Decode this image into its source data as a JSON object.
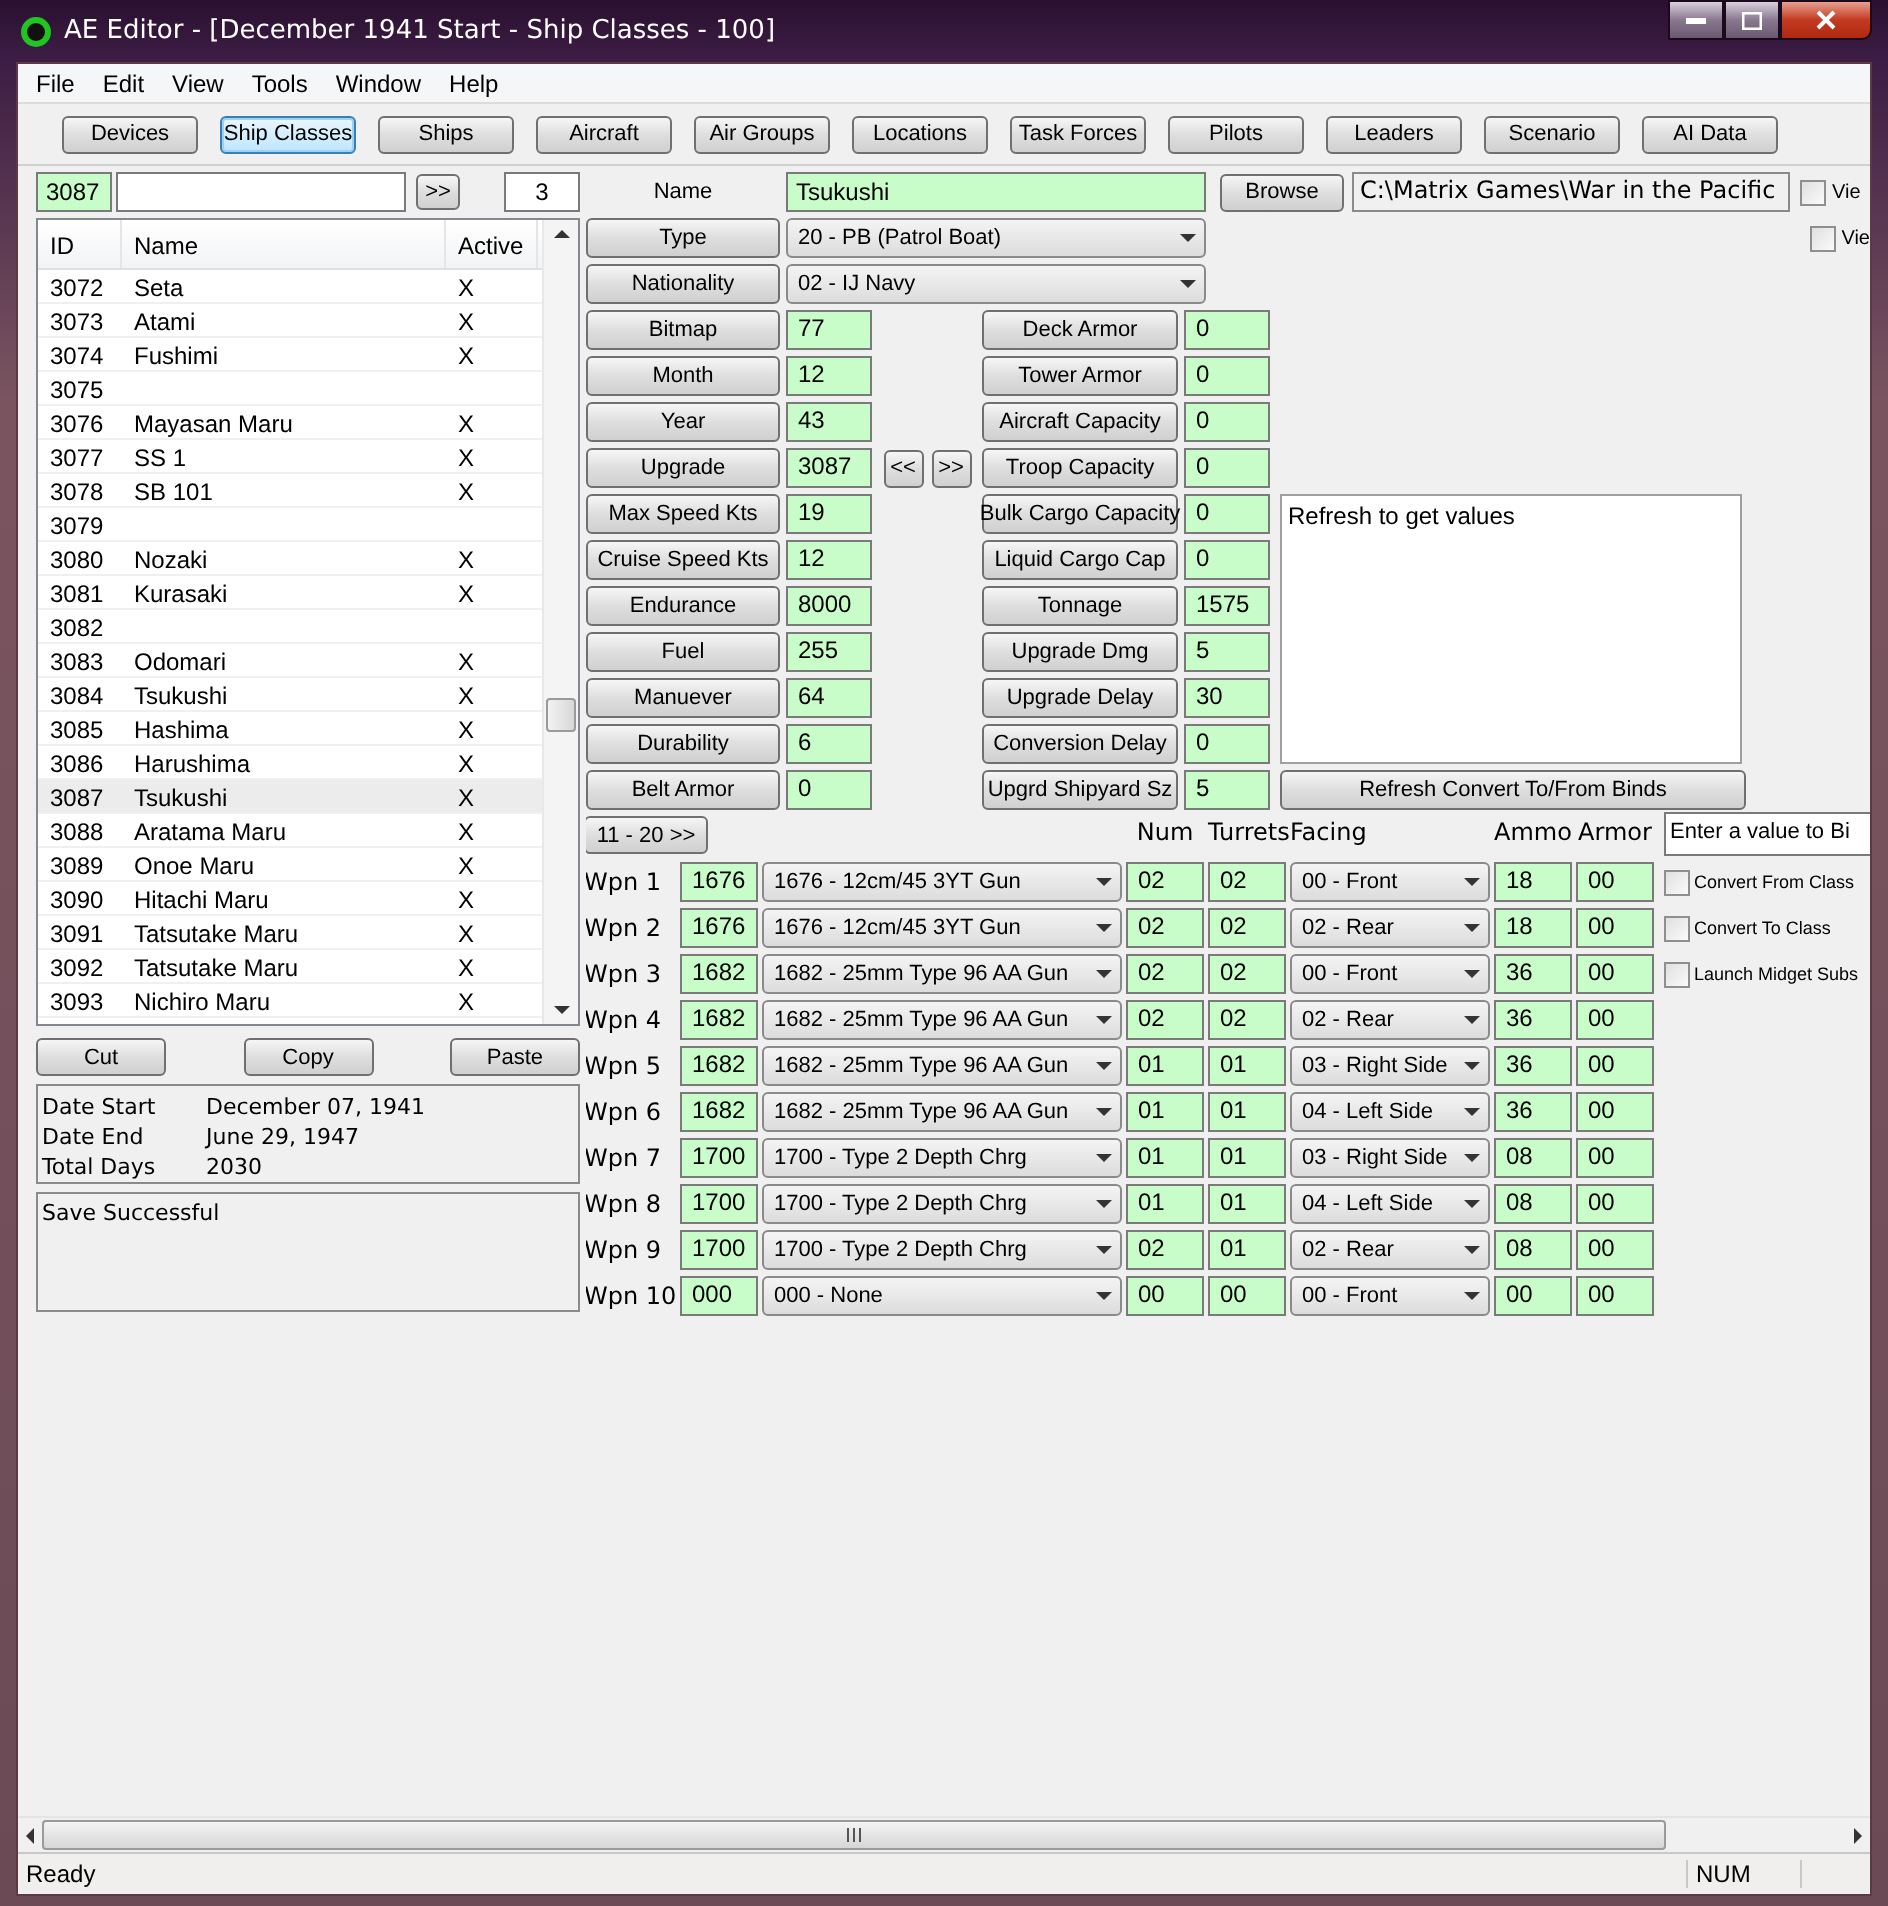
{
  "window": {
    "title": "AE Editor - [December 1941 Start - Ship Classes - 100]"
  },
  "menu": [
    "File",
    "Edit",
    "View",
    "Tools",
    "Window",
    "Help"
  ],
  "toolbar": [
    {
      "label": "Devices",
      "selected": false
    },
    {
      "label": "Ship Classes",
      "selected": true
    },
    {
      "label": "Ships",
      "selected": false
    },
    {
      "label": "Aircraft",
      "selected": false
    },
    {
      "label": "Air Groups",
      "selected": false
    },
    {
      "label": "Locations",
      "selected": false
    },
    {
      "label": "Task Forces",
      "selected": false
    },
    {
      "label": "Pilots",
      "selected": false
    },
    {
      "label": "Leaders",
      "selected": false
    },
    {
      "label": "Scenario",
      "selected": false
    },
    {
      "label": "AI Data",
      "selected": false
    }
  ],
  "list_panel": {
    "id_field": "3087",
    "next_button": ">>",
    "count": "3",
    "columns": [
      "ID",
      "Name",
      "Active"
    ],
    "rows": [
      {
        "id": "3072",
        "name": "Seta",
        "active": "X",
        "selected": false
      },
      {
        "id": "3073",
        "name": "Atami",
        "active": "X",
        "selected": false
      },
      {
        "id": "3074",
        "name": "Fushimi",
        "active": "X",
        "selected": false
      },
      {
        "id": "3075",
        "selected": false
      },
      {
        "id": "3076",
        "name": "Mayasan Maru",
        "active": "X",
        "selected": false
      },
      {
        "id": "3077",
        "name": "SS 1",
        "active": "X",
        "selected": false
      },
      {
        "id": "3078",
        "name": "SB 101",
        "active": "X",
        "selected": false
      },
      {
        "id": "3079",
        "selected": false
      },
      {
        "id": "3080",
        "name": "Nozaki",
        "active": "X",
        "selected": false
      },
      {
        "id": "3081",
        "name": "Kurasaki",
        "active": "X",
        "selected": false
      },
      {
        "id": "3082",
        "selected": false
      },
      {
        "id": "3083",
        "name": "Odomari",
        "active": "X",
        "selected": false
      },
      {
        "id": "3084",
        "name": "Tsukushi",
        "active": "X",
        "selected": false
      },
      {
        "id": "3085",
        "name": "Hashima",
        "active": "X",
        "selected": false
      },
      {
        "id": "3086",
        "name": "Harushima",
        "active": "X",
        "selected": false
      },
      {
        "id": "3087",
        "name": "Tsukushi",
        "active": "X",
        "selected": true
      },
      {
        "id": "3088",
        "name": "Aratama Maru",
        "active": "X",
        "selected": false
      },
      {
        "id": "3089",
        "name": "Onoe Maru",
        "active": "X",
        "selected": false
      },
      {
        "id": "3090",
        "name": "Hitachi Maru",
        "active": "X",
        "selected": false
      },
      {
        "id": "3091",
        "name": "Tatsutake Maru",
        "active": "X",
        "selected": false
      },
      {
        "id": "3092",
        "name": "Tatsutake Maru",
        "active": "X",
        "selected": false
      },
      {
        "id": "3093",
        "name": "Nichiro Maru",
        "active": "X",
        "selected": false
      }
    ],
    "buttons": [
      "Cut",
      "Copy",
      "Paste"
    ],
    "dates": [
      {
        "label": "Date Start",
        "value": "December 07, 1941"
      },
      {
        "label": "Date End",
        "value": "June 29, 1947"
      },
      {
        "label": "Total Days",
        "value": "2030"
      }
    ],
    "message": "Save Successful"
  },
  "ship": {
    "name_label": "Name",
    "name": "Tsukushi",
    "browse_button": "Browse",
    "path": "C:\\Matrix Games\\War in the Pacific",
    "view_checks": [
      {
        "label": "Vie",
        "checked": false
      },
      {
        "label": "Vie",
        "checked": false
      }
    ],
    "type": {
      "label": "Type",
      "value": "20 - PB (Patrol Boat)"
    },
    "nationality": {
      "label": "Nationality",
      "value": "02 - IJ Navy"
    },
    "left_fields": [
      {
        "label": "Bitmap",
        "value": "77"
      },
      {
        "label": "Month",
        "value": "12"
      },
      {
        "label": "Year",
        "value": "43"
      },
      {
        "label": "Upgrade",
        "value": "3087",
        "arrows": [
          "<<",
          ">>"
        ]
      },
      {
        "label": "Max Speed Kts",
        "value": "19"
      },
      {
        "label": "Cruise Speed Kts",
        "value": "12"
      },
      {
        "label": "Endurance",
        "value": "8000"
      },
      {
        "label": "Fuel",
        "value": "255"
      },
      {
        "label": "Manuever",
        "value": "64"
      },
      {
        "label": "Durability",
        "value": "6"
      },
      {
        "label": "Belt Armor",
        "value": "0"
      }
    ],
    "right_fields": [
      {
        "label": "Deck Armor",
        "value": "0"
      },
      {
        "label": "Tower Armor",
        "value": "0"
      },
      {
        "label": "Aircraft Capacity",
        "value": "0"
      },
      {
        "label": "Troop Capacity",
        "value": "0"
      },
      {
        "label": "Bulk Cargo Capacity",
        "value": "0"
      },
      {
        "label": "Liquid Cargo Cap",
        "value": "0"
      },
      {
        "label": "Tonnage",
        "value": "1575"
      },
      {
        "label": "Upgrade Dmg",
        "value": "5"
      },
      {
        "label": "Upgrade Delay",
        "value": "30"
      },
      {
        "label": "Conversion Delay",
        "value": "0"
      },
      {
        "label": "Upgrd Shipyard Sz",
        "value": "5"
      }
    ],
    "notes": "Refresh to get values",
    "refresh_button": "Refresh Convert To/From Binds"
  },
  "weapons": {
    "page_button": "11 - 20 >>",
    "columns": [
      "Num",
      "Turrets",
      "Facing",
      "Ammo",
      "Armor"
    ],
    "bind_field": "Enter a value to Bi",
    "rows": [
      {
        "label": "Wpn 1",
        "id": "1676",
        "device": "1676 - 12cm/45 3YT Gun",
        "num": "02",
        "turrets": "02",
        "facing": "00 - Front",
        "ammo": "18",
        "armor": "00"
      },
      {
        "label": "Wpn 2",
        "id": "1676",
        "device": "1676 - 12cm/45 3YT Gun",
        "num": "02",
        "turrets": "02",
        "facing": "02 - Rear",
        "ammo": "18",
        "armor": "00"
      },
      {
        "label": "Wpn 3",
        "id": "1682",
        "device": "1682 - 25mm Type 96 AA Gun",
        "num": "02",
        "turrets": "02",
        "facing": "00 - Front",
        "ammo": "36",
        "armor": "00"
      },
      {
        "label": "Wpn 4",
        "id": "1682",
        "device": "1682 - 25mm Type 96 AA Gun",
        "num": "02",
        "turrets": "02",
        "facing": "02 - Rear",
        "ammo": "36",
        "armor": "00"
      },
      {
        "label": "Wpn 5",
        "id": "1682",
        "device": "1682 - 25mm Type 96 AA Gun",
        "num": "01",
        "turrets": "01",
        "facing": "03 - Right Side",
        "ammo": "36",
        "armor": "00"
      },
      {
        "label": "Wpn 6",
        "id": "1682",
        "device": "1682 - 25mm Type 96 AA Gun",
        "num": "01",
        "turrets": "01",
        "facing": "04 - Left Side",
        "ammo": "36",
        "armor": "00"
      },
      {
        "label": "Wpn 7",
        "id": "1700",
        "device": "1700 - Type 2 Depth Chrg",
        "num": "01",
        "turrets": "01",
        "facing": "03 - Right Side",
        "ammo": "08",
        "armor": "00"
      },
      {
        "label": "Wpn 8",
        "id": "1700",
        "device": "1700 - Type 2 Depth Chrg",
        "num": "01",
        "turrets": "01",
        "facing": "04 - Left Side",
        "ammo": "08",
        "armor": "00"
      },
      {
        "label": "Wpn 9",
        "id": "1700",
        "device": "1700 - Type 2 Depth Chrg",
        "num": "02",
        "turrets": "01",
        "facing": "02 - Rear",
        "ammo": "08",
        "armor": "00"
      },
      {
        "label": "Wpn 10",
        "id": "000",
        "device": "000 - None",
        "num": "00",
        "turrets": "00",
        "facing": "00 - Front",
        "ammo": "00",
        "armor": "00"
      }
    ],
    "options": [
      {
        "label": "Convert From Class",
        "checked": false
      },
      {
        "label": "Convert To Class",
        "checked": false
      },
      {
        "label": "Launch Midget Subs",
        "checked": false
      }
    ]
  },
  "status_bar": {
    "message": "Ready",
    "num": "NUM"
  }
}
